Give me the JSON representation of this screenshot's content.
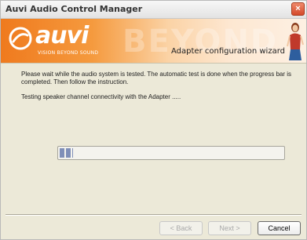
{
  "window": {
    "title": "Auvi Audio Control Manager",
    "close_glyph": "×"
  },
  "banner": {
    "logo_text": "auvi",
    "logo_tagline": "VISION BEYOND SOUND",
    "watermark": "BEYOND",
    "wizard_title": "Adapter configuration wizard",
    "colors": {
      "orange": "#ef7a1e",
      "light": "#fde7d1"
    },
    "mascot_icon": "woman-figure-icon"
  },
  "content": {
    "instruction": "Please wait while the audio system is tested. The automatic test is done when the progress bar is completed. Then follow the instruction.",
    "status": "Testing speaker channel connectivity with the Adapter .....",
    "progress_fraction": 0.06
  },
  "buttons": {
    "back": "< Back",
    "next": "Next >",
    "cancel": "Cancel"
  }
}
